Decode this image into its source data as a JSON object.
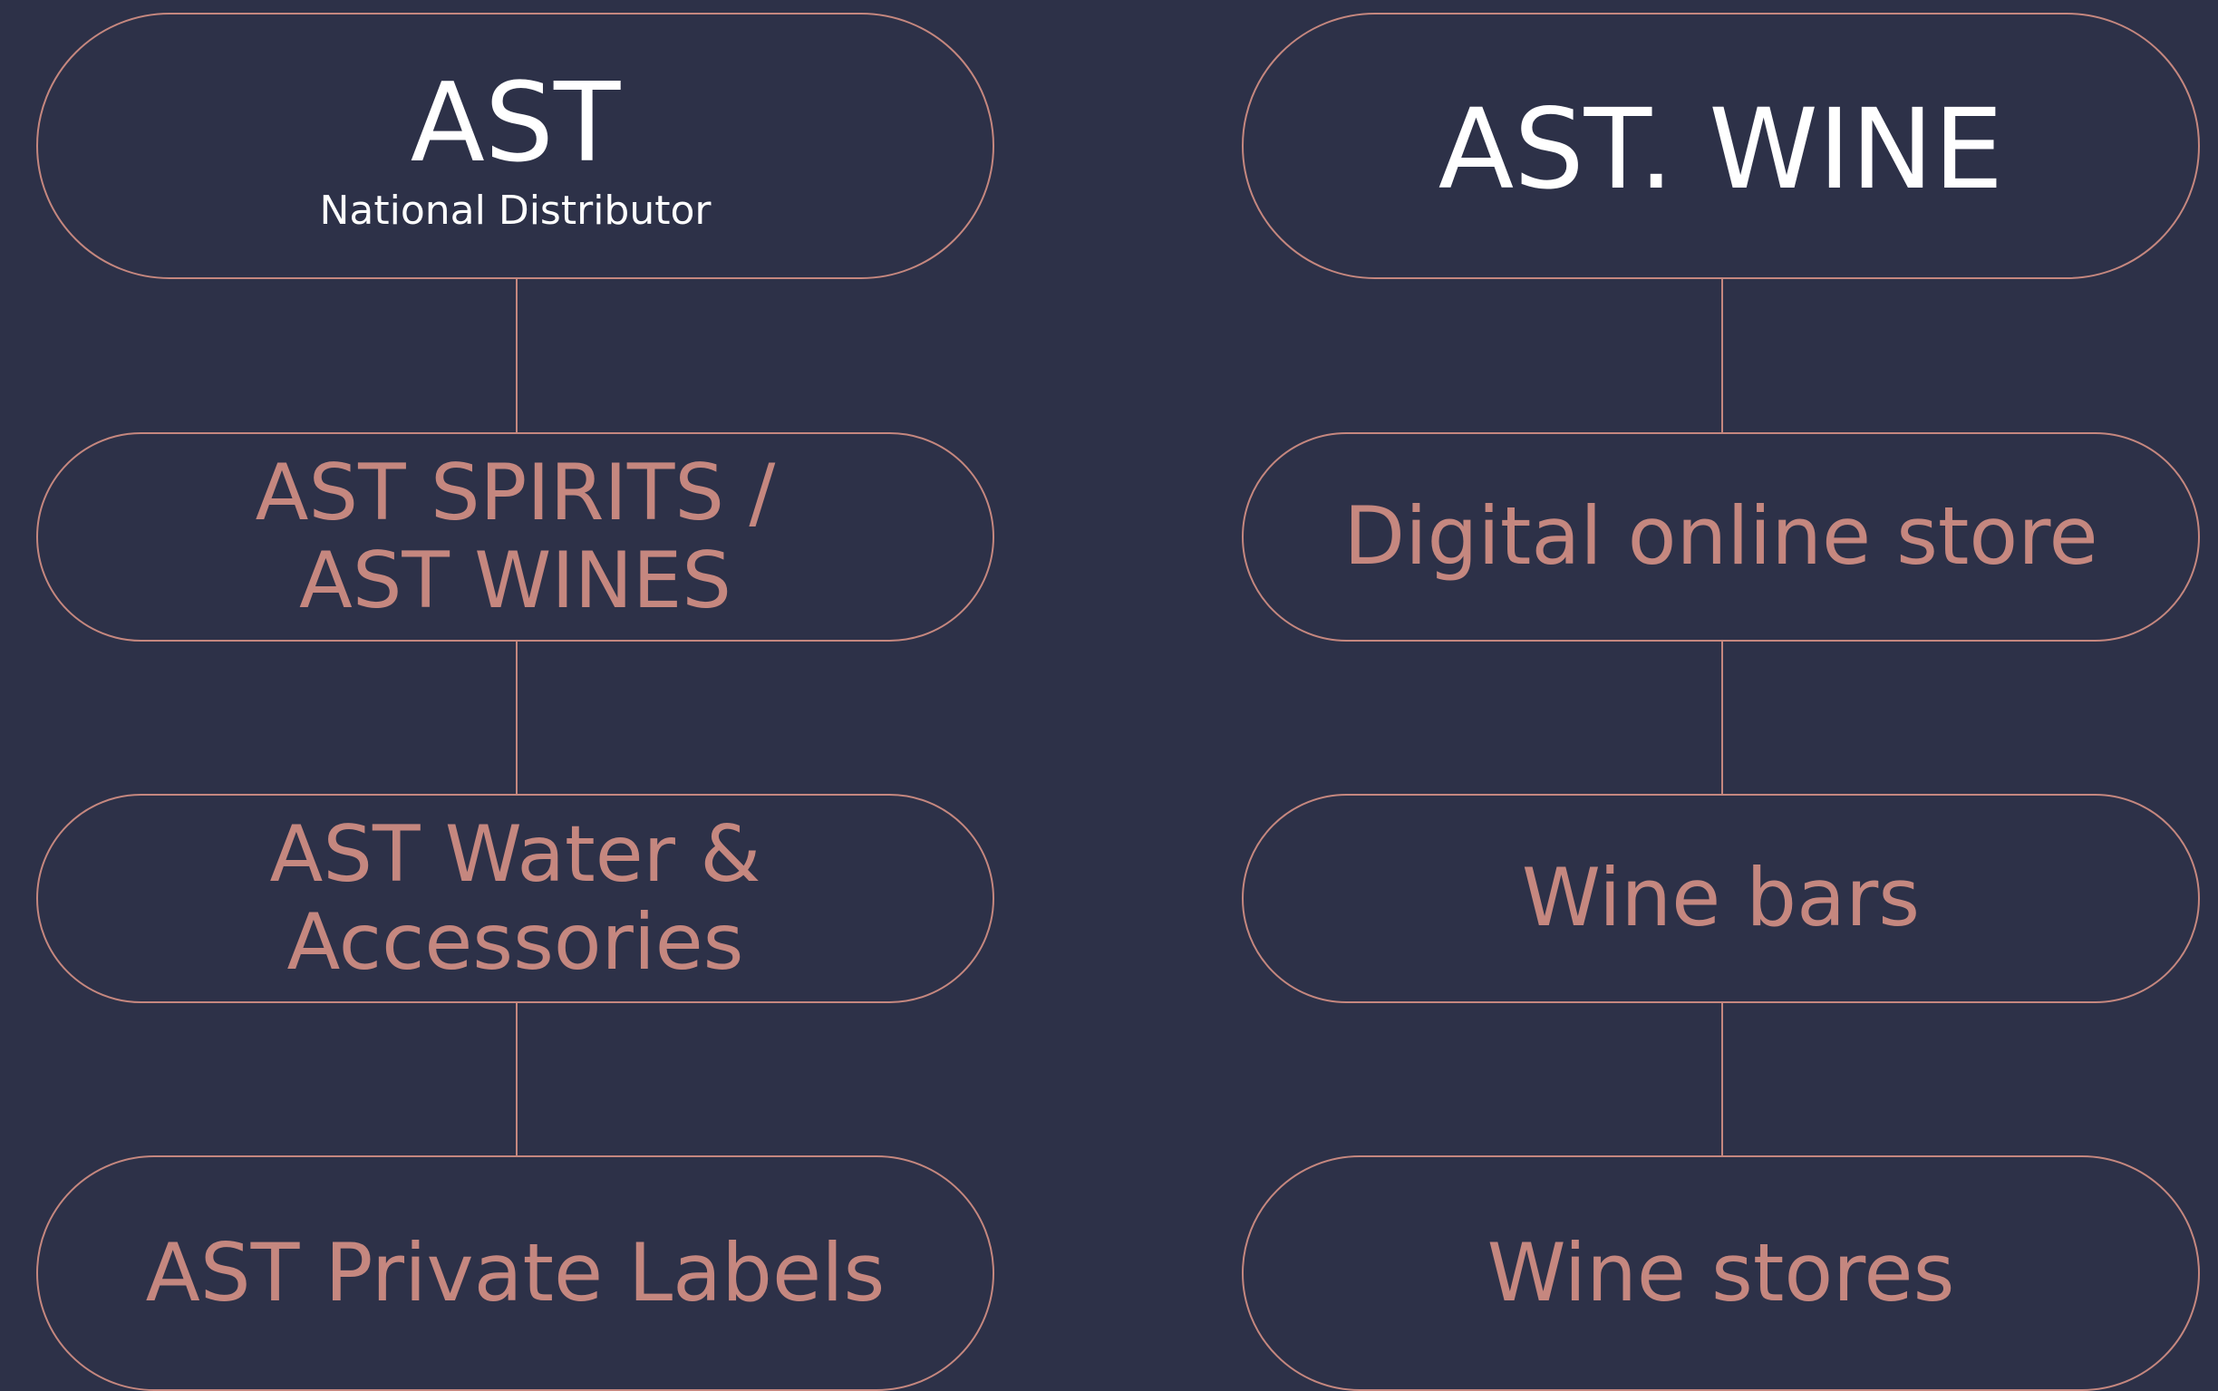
{
  "colors": {
    "background": "#2d3148",
    "accent": "#c5877f",
    "heading_text": "#ffffff"
  },
  "left_column": {
    "header": {
      "title": "AST",
      "subtitle": "National Distributor"
    },
    "nodes": [
      {
        "label": "AST SPIRITS /\nAST WINES"
      },
      {
        "label": "AST Water &\nAccessories"
      },
      {
        "label": "AST Private Labels"
      }
    ]
  },
  "right_column": {
    "header": {
      "title": "AST. WINE"
    },
    "nodes": [
      {
        "label": "Digital online store"
      },
      {
        "label": "Wine bars"
      },
      {
        "label": "Wine stores"
      }
    ]
  }
}
